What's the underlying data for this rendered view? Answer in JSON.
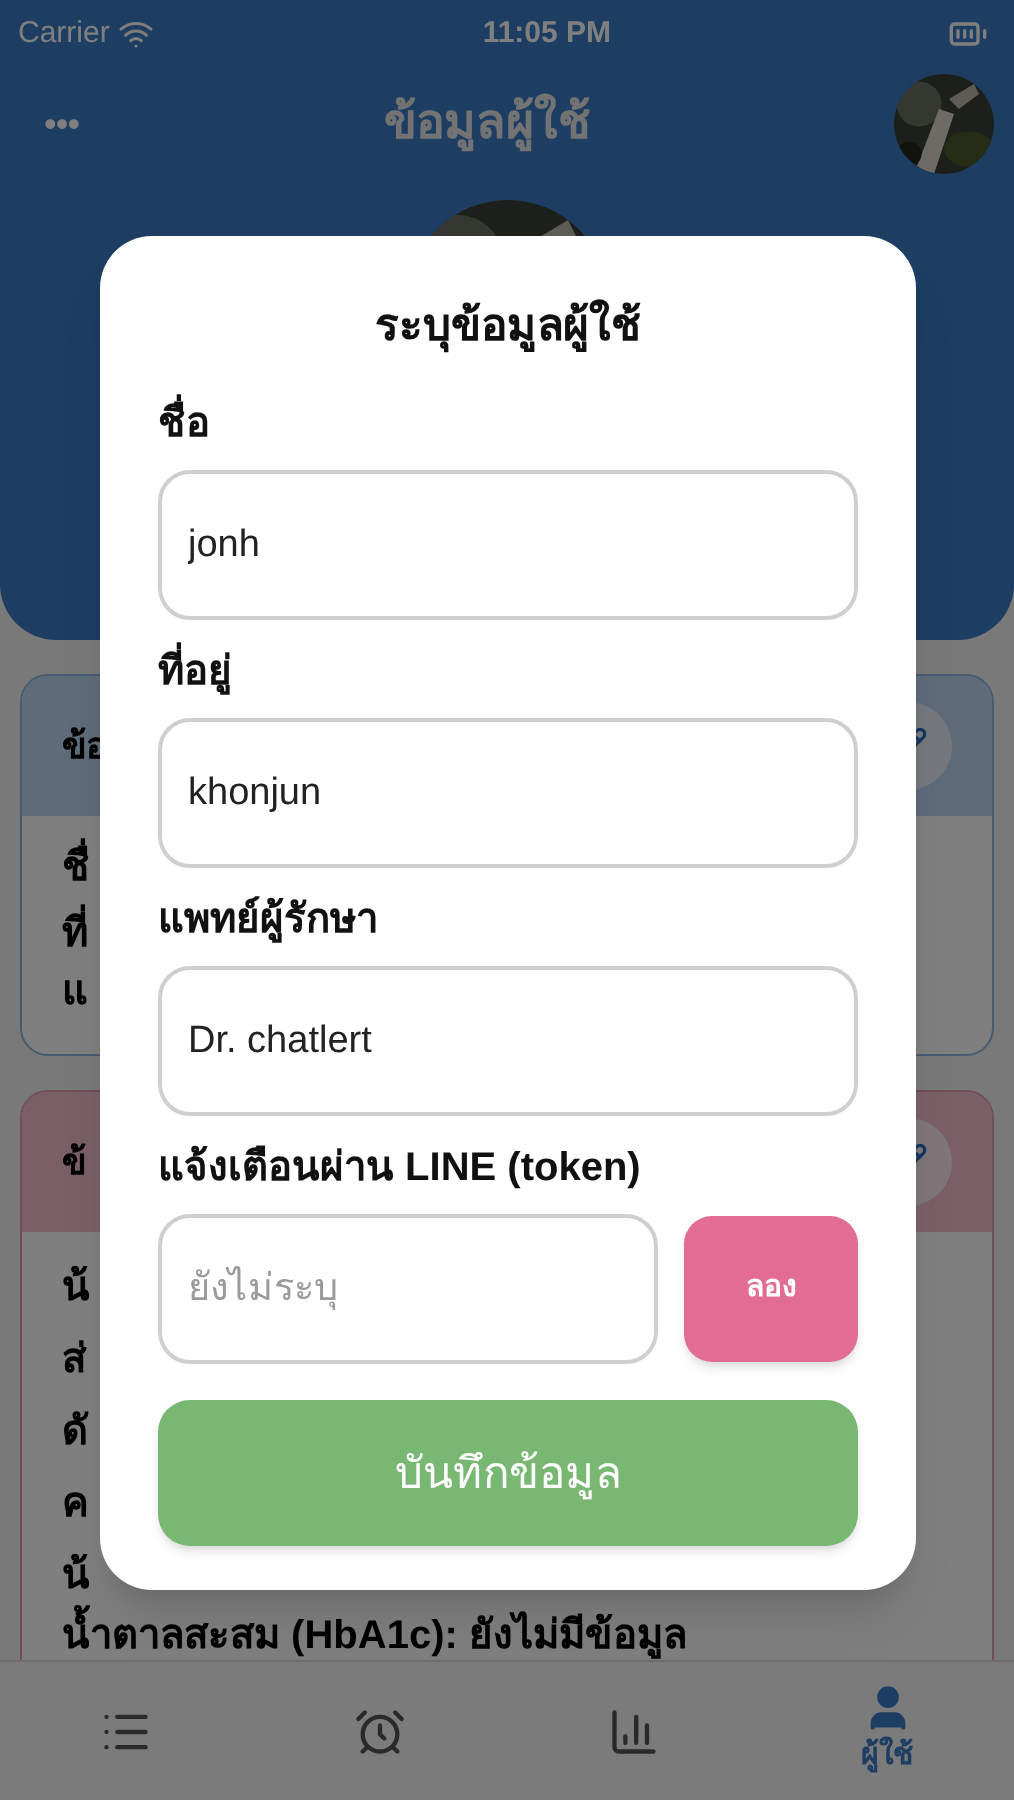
{
  "status_bar": {
    "carrier": "Carrier",
    "time": "11:05 PM"
  },
  "header": {
    "menu": "•••",
    "title": "ข้อมูลผู้ใช้"
  },
  "cards": [
    {
      "kind": "profile",
      "title": "ข้อ",
      "lines": [
        "ชื่",
        "ที่",
        "แ"
      ]
    },
    {
      "kind": "health",
      "title": "ข้",
      "lines": [
        "น้",
        "ส่",
        "ดั",
        "ค",
        "น้",
        "น้ำตาลสะสม (HbA1c): ยังไม่มีข้อมูล"
      ]
    }
  ],
  "dialog": {
    "title": "ระบุข้อมูลผู้ใช้",
    "fields": [
      {
        "label": "ชื่อ",
        "value": "jonh"
      },
      {
        "label": "ที่อยู่",
        "value": "khonjun"
      },
      {
        "label": "แพทย์ผู้รักษา",
        "value": "Dr. chatlert"
      }
    ],
    "token": {
      "label": "แจ้งเตือนผ่าน LINE (token)",
      "placeholder": "ยังไม่ระบุ",
      "test_button": "ลอง"
    },
    "save_button": "บันทึกข้อมูล"
  },
  "tabs": [
    {
      "kind": "list",
      "selected": false
    },
    {
      "kind": "alarm",
      "selected": false
    },
    {
      "kind": "chart",
      "selected": false
    },
    {
      "kind": "user",
      "label": "ผู้ใช้",
      "selected": true
    }
  ]
}
